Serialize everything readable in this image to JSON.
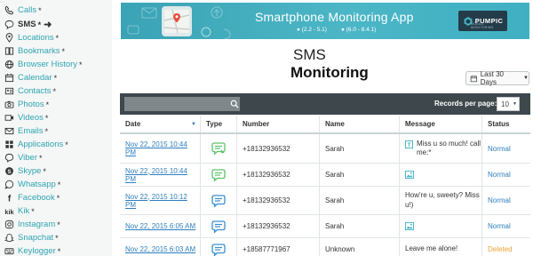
{
  "sidebar": {
    "items": [
      {
        "label": "Calls",
        "icon": "phone-icon",
        "star": "*",
        "active": false
      },
      {
        "label": "SMS",
        "icon": "chat-bubble-icon",
        "star": "*",
        "active": true
      },
      {
        "label": "Locations",
        "icon": "map-pin-icon",
        "star": "*",
        "active": false
      },
      {
        "label": "Bookmarks",
        "icon": "book-icon",
        "star": "*",
        "active": false
      },
      {
        "label": "Browser History",
        "icon": "globe-icon",
        "star": "*",
        "active": false
      },
      {
        "label": "Calendar",
        "icon": "calendar-icon",
        "star": "*",
        "active": false
      },
      {
        "label": "Contacts",
        "icon": "contact-card-icon",
        "star": "*",
        "active": false
      },
      {
        "label": "Photos",
        "icon": "camera-icon",
        "star": "*",
        "active": false
      },
      {
        "label": "Videos",
        "icon": "video-icon",
        "star": "*",
        "active": false
      },
      {
        "label": "Emails",
        "icon": "envelope-icon",
        "star": "*",
        "active": false
      },
      {
        "label": "Applications",
        "icon": "apps-icon",
        "star": "*",
        "active": false
      },
      {
        "label": "Viber",
        "icon": "viber-icon",
        "star": "*",
        "active": false
      },
      {
        "label": "Skype",
        "icon": "skype-icon",
        "star": "*",
        "active": false
      },
      {
        "label": "Whatsapp",
        "icon": "whatsapp-icon",
        "star": "*",
        "active": false
      },
      {
        "label": "Facebook",
        "icon": "facebook-icon",
        "star": "*",
        "active": false
      },
      {
        "label": "Kik",
        "icon": "kik-icon",
        "star": "*",
        "active": false
      },
      {
        "label": "Instagram",
        "icon": "instagram-icon",
        "star": "*",
        "active": false
      },
      {
        "label": "Snapchat",
        "icon": "snapchat-icon",
        "star": "*",
        "active": false
      },
      {
        "label": "Keylogger",
        "icon": "keyboard-icon",
        "star": "*",
        "active": false
      }
    ]
  },
  "banner": {
    "title": "Smartphone Monitoring App",
    "android_version": "(2.2 - 5.1)",
    "ios_version": "(6.0 - 8.4.1)",
    "logo_text": "PUMPIC",
    "logo_subtext": "MOBILE MONITORING",
    "colors": {
      "background": "#45b1c2",
      "logo_bg": "#243b4a"
    }
  },
  "page": {
    "subtitle": "SMS",
    "title": "Monitoring",
    "range_label": "Last 30 Days"
  },
  "toolbar": {
    "search_placeholder": "",
    "records_label": "Records per page:",
    "records_value": "10"
  },
  "table": {
    "headers": {
      "date": "Date",
      "type": "Type",
      "number": "Number",
      "name": "Name",
      "message": "Message",
      "status": "Status"
    },
    "rows": [
      {
        "date": "Nov 22, 2015 10:44 PM",
        "type": "incoming-sms-icon",
        "number": "+18132936532",
        "name": "Sarah",
        "message": "Miss u so much! call me:*",
        "message_icon": "text-attachment-icon",
        "status": "Normal"
      },
      {
        "date": "Nov 22, 2015 10:44 PM",
        "type": "incoming-sms-icon",
        "number": "+18132936532",
        "name": "Sarah",
        "message": "",
        "message_icon": "image-attachment-icon",
        "status": "Normal"
      },
      {
        "date": "Nov 22, 2015 10:12 PM",
        "type": "outgoing-sms-icon",
        "number": "+18132936532",
        "name": "Sarah",
        "message": "How're u, sweety? Miss u!)",
        "message_icon": "",
        "status": "Normal"
      },
      {
        "date": "Nov 22, 2015 6:05 AM",
        "type": "outgoing-sms-icon",
        "number": "+18132936532",
        "name": "Sarah",
        "message": "",
        "message_icon": "image-attachment-icon",
        "status": "Normal"
      },
      {
        "date": "Nov 22, 2015 6:03 AM",
        "type": "outgoing-sms-icon",
        "number": "+18587771967",
        "name": "Unknown",
        "message": "Leave me alone!",
        "message_icon": "",
        "status": "Deleted"
      }
    ],
    "colors": {
      "link": "#2d7fbf",
      "normal": "#2d7fbf",
      "deleted": "#e8a236",
      "incoming": "#5cc36b",
      "outgoing": "#3b8fd0"
    }
  }
}
